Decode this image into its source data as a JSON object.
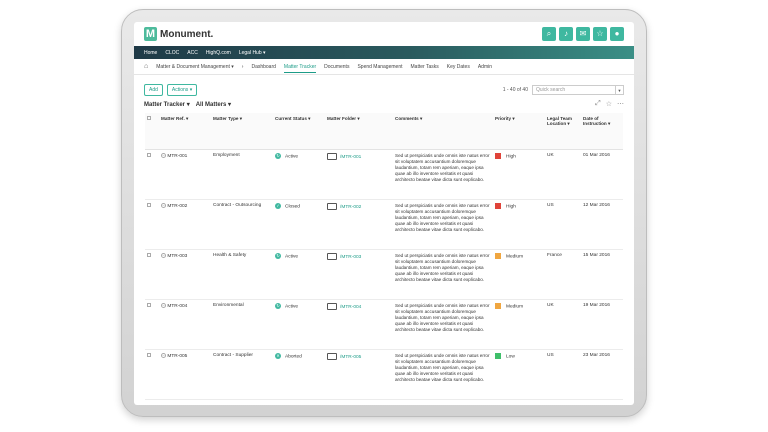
{
  "app": {
    "logo_text": "Monument."
  },
  "top_icons": [
    "search-icon",
    "bell-icon",
    "mail-icon",
    "star-icon",
    "user-icon"
  ],
  "nav": [
    "Home",
    "CLOC",
    "ACC",
    "HighQ.com",
    "Legal Hub ▾"
  ],
  "subnav": [
    "Matter & Document Management ▾",
    "Dashboard",
    "Matter Tracker",
    "Documents",
    "Spend Management",
    "Matter Tasks",
    "Key Dates",
    "Admin"
  ],
  "toolbar": {
    "add": "Add",
    "actions": "Actions ▾",
    "count": "1 - 40 of 40",
    "search_placeholder": "Quick search"
  },
  "view": {
    "name": "Matter Tracker ▾",
    "filter": "All Matters ▾"
  },
  "columns": [
    "Matter Ref. ▾",
    "Matter Type ▾",
    "Current Status ▾",
    "Matter Folder ▾",
    "Comments ▾",
    "Priority ▾",
    "Legal Team Location ▾",
    "Date of Instruction ▾"
  ],
  "comment_text": "Sed ut perspiciatis unde omnis iste natus error sit voluptatem accusantium doloremque laudantium, totam rem aperiam, eaque ipsa quae ab illo inventore veritatis et quasi architecto beatae vitae dicta sunt explicabo.",
  "rows": [
    {
      "ref": "MTR-001",
      "type": "Employment",
      "status": "Active",
      "status_color": "#3fb8a0",
      "status_glyph": "↻",
      "folder": "/MTR-001",
      "priority": "High",
      "prio_color": "#e0443a",
      "location": "UK",
      "date": "01 Mar 2016"
    },
    {
      "ref": "MTR-002",
      "type": "Contract - Outsourcing",
      "status": "Closed",
      "status_color": "#3fb8a0",
      "status_glyph": "✓",
      "folder": "/MTR-002",
      "priority": "High",
      "prio_color": "#e0443a",
      "location": "US",
      "date": "12 Mar 2016"
    },
    {
      "ref": "MTR-003",
      "type": "Health & Safety",
      "status": "Active",
      "status_color": "#3fb8a0",
      "status_glyph": "↻",
      "folder": "/MTR-003",
      "priority": "Medium",
      "prio_color": "#f0a640",
      "location": "France",
      "date": "15 Mar 2016"
    },
    {
      "ref": "MTR-004",
      "type": "Environmental",
      "status": "Active",
      "status_color": "#3fb8a0",
      "status_glyph": "↻",
      "folder": "/MTR-004",
      "priority": "Medium",
      "prio_color": "#f0a640",
      "location": "UK",
      "date": "19 Mar 2016"
    },
    {
      "ref": "MTR-005",
      "type": "Contract - Supplier",
      "status": "Aborted",
      "status_color": "#3fb8a0",
      "status_glyph": "✕",
      "folder": "/MTR-005",
      "priority": "Low",
      "prio_color": "#3fbf6a",
      "location": "US",
      "date": "23 Mar 2016"
    }
  ]
}
